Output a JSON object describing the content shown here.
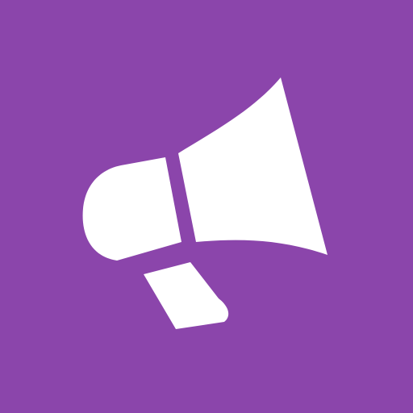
{
  "icon": {
    "name": "megaphone-icon",
    "background_color": "#8B45AB",
    "glyph_color": "#FFFFFF"
  }
}
